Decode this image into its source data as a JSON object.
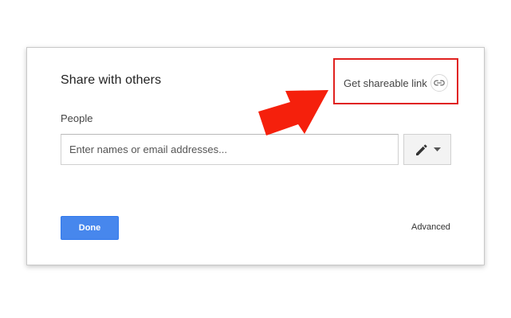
{
  "dialog": {
    "title": "Share with others",
    "share_link": {
      "label": "Get shareable link",
      "icon": "link-icon"
    },
    "people": {
      "label": "People",
      "input_value": "",
      "input_placeholder": "Enter names or email addresses...",
      "permission_icon": "pencil-icon",
      "dropdown_icon": "caret-down-icon"
    },
    "done_label": "Done",
    "advanced_label": "Advanced"
  },
  "annotation": {
    "highlight_color": "#e0211f",
    "arrow_color": "#f5200c",
    "arrow_icon": "red-arrow"
  },
  "colors": {
    "primary_button": "#4787ed",
    "dialog_border": "#c8c8c8"
  }
}
